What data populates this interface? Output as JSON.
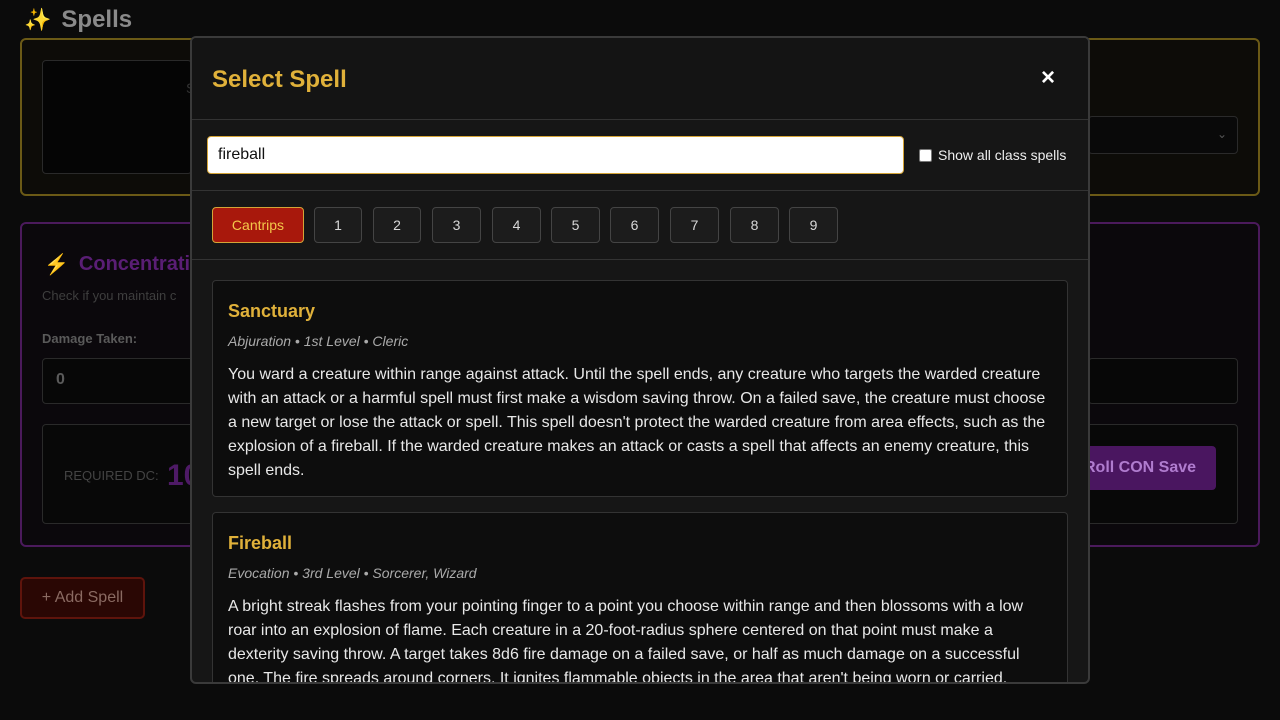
{
  "background": {
    "page_title": "Spells",
    "section_top": {
      "inner_text": "S"
    },
    "concentration": {
      "title": "Concentrati",
      "description": "Check if you maintain c",
      "damage_label": "Damage Taken:",
      "damage_value": "0",
      "required_dc_label": "REQUIRED DC:",
      "required_dc_value": "10",
      "roll_button": "Roll CON Save"
    },
    "add_spell_button": "+ Add Spell"
  },
  "modal": {
    "title": "Select Spell",
    "close_icon": "×",
    "search": {
      "value": "fireball",
      "placeholder": ""
    },
    "show_all_label": "Show all class spells",
    "show_all_checked": false,
    "levels": [
      {
        "label": "Cantrips",
        "active": true
      },
      {
        "label": "1",
        "active": false
      },
      {
        "label": "2",
        "active": false
      },
      {
        "label": "3",
        "active": false
      },
      {
        "label": "4",
        "active": false
      },
      {
        "label": "5",
        "active": false
      },
      {
        "label": "6",
        "active": false
      },
      {
        "label": "7",
        "active": false
      },
      {
        "label": "8",
        "active": false
      },
      {
        "label": "9",
        "active": false
      }
    ],
    "spells": [
      {
        "name": "Sanctuary",
        "meta": "Abjuration • 1st Level • Cleric",
        "description": "You ward a creature within range against attack. Until the spell ends, any creature who targets the warded creature with an attack or a harmful spell must first make a wisdom saving throw. On a failed save, the creature must choose a new target or lose the attack or spell. This spell doesn't protect the warded creature from area effects, such as the explosion of a fireball. If the warded creature makes an attack or casts a spell that affects an enemy creature, this spell ends."
      },
      {
        "name": "Fireball",
        "meta": "Evocation • 3rd Level • Sorcerer, Wizard",
        "description": "A bright streak flashes from your pointing finger to a point you choose within range and then blossoms with a low roar into an explosion of flame. Each creature in a 20-foot-radius sphere centered on that point must make a dexterity saving throw. A target takes 8d6 fire damage on a failed save, or half as much damage on a successful one. The fire spreads around corners. It ignites flammable objects in the area that aren't being worn or carried."
      }
    ]
  },
  "colors": {
    "accent_gold": "#e0b13a",
    "active_level_bg": "#a8180c",
    "concentration_purple": "#4b1a5c"
  }
}
